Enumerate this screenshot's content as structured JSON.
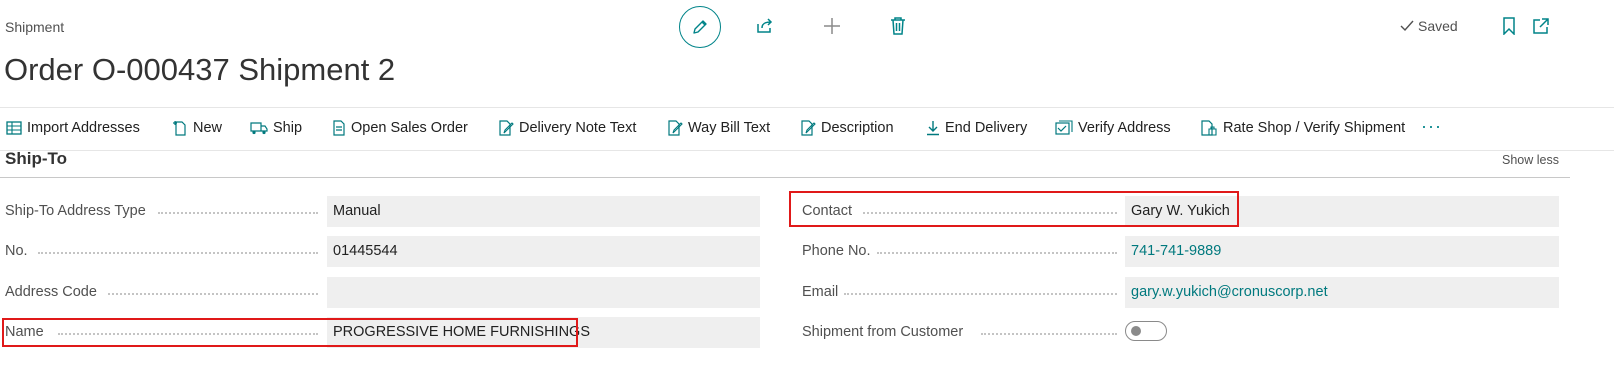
{
  "header": {
    "caption": "Shipment",
    "title": "Order O-000437 Shipment 2",
    "status": "Saved",
    "icons": [
      "edit-icon",
      "share-icon",
      "add-icon",
      "delete-icon",
      "bookmark-icon",
      "open-new-window-icon"
    ]
  },
  "actions": [
    {
      "label": "Import Addresses",
      "icon": "import-addresses-icon"
    },
    {
      "label": "New",
      "icon": "new-document-icon"
    },
    {
      "label": "Ship",
      "icon": "ship-truck-icon"
    },
    {
      "label": "Open Sales Order",
      "icon": "document-icon"
    },
    {
      "label": "Delivery Note Text",
      "icon": "edit-document-icon"
    },
    {
      "label": "Way Bill Text",
      "icon": "edit-document-icon"
    },
    {
      "label": "Description",
      "icon": "edit-document-icon"
    },
    {
      "label": "End Delivery",
      "icon": "download-arrow-icon"
    },
    {
      "label": "Verify Address",
      "icon": "verify-address-icon"
    },
    {
      "label": "Rate Shop / Verify Shipment",
      "icon": "rate-shop-icon"
    }
  ],
  "more_label": "···",
  "section": {
    "title": "Ship-To",
    "toggle_label": "Show less"
  },
  "left_fields": [
    {
      "label": "Ship-To Address Type",
      "value": "Manual"
    },
    {
      "label": "No.",
      "value": "01445544"
    },
    {
      "label": "Address Code",
      "value": ""
    },
    {
      "label": "Name",
      "value": "PROGRESSIVE HOME FURNISHINGS"
    }
  ],
  "right_fields": [
    {
      "label": "Contact",
      "value": "Gary W. Yukich"
    },
    {
      "label": "Phone No.",
      "value": "741-741-9889"
    },
    {
      "label": "Email",
      "value": "gary.w.yukich@cronuscorp.net"
    },
    {
      "label": "Shipment from Customer",
      "value_toggle": false
    }
  ],
  "colors": {
    "accent": "#008489",
    "highlight": "#e01919",
    "link": "#00797e"
  }
}
